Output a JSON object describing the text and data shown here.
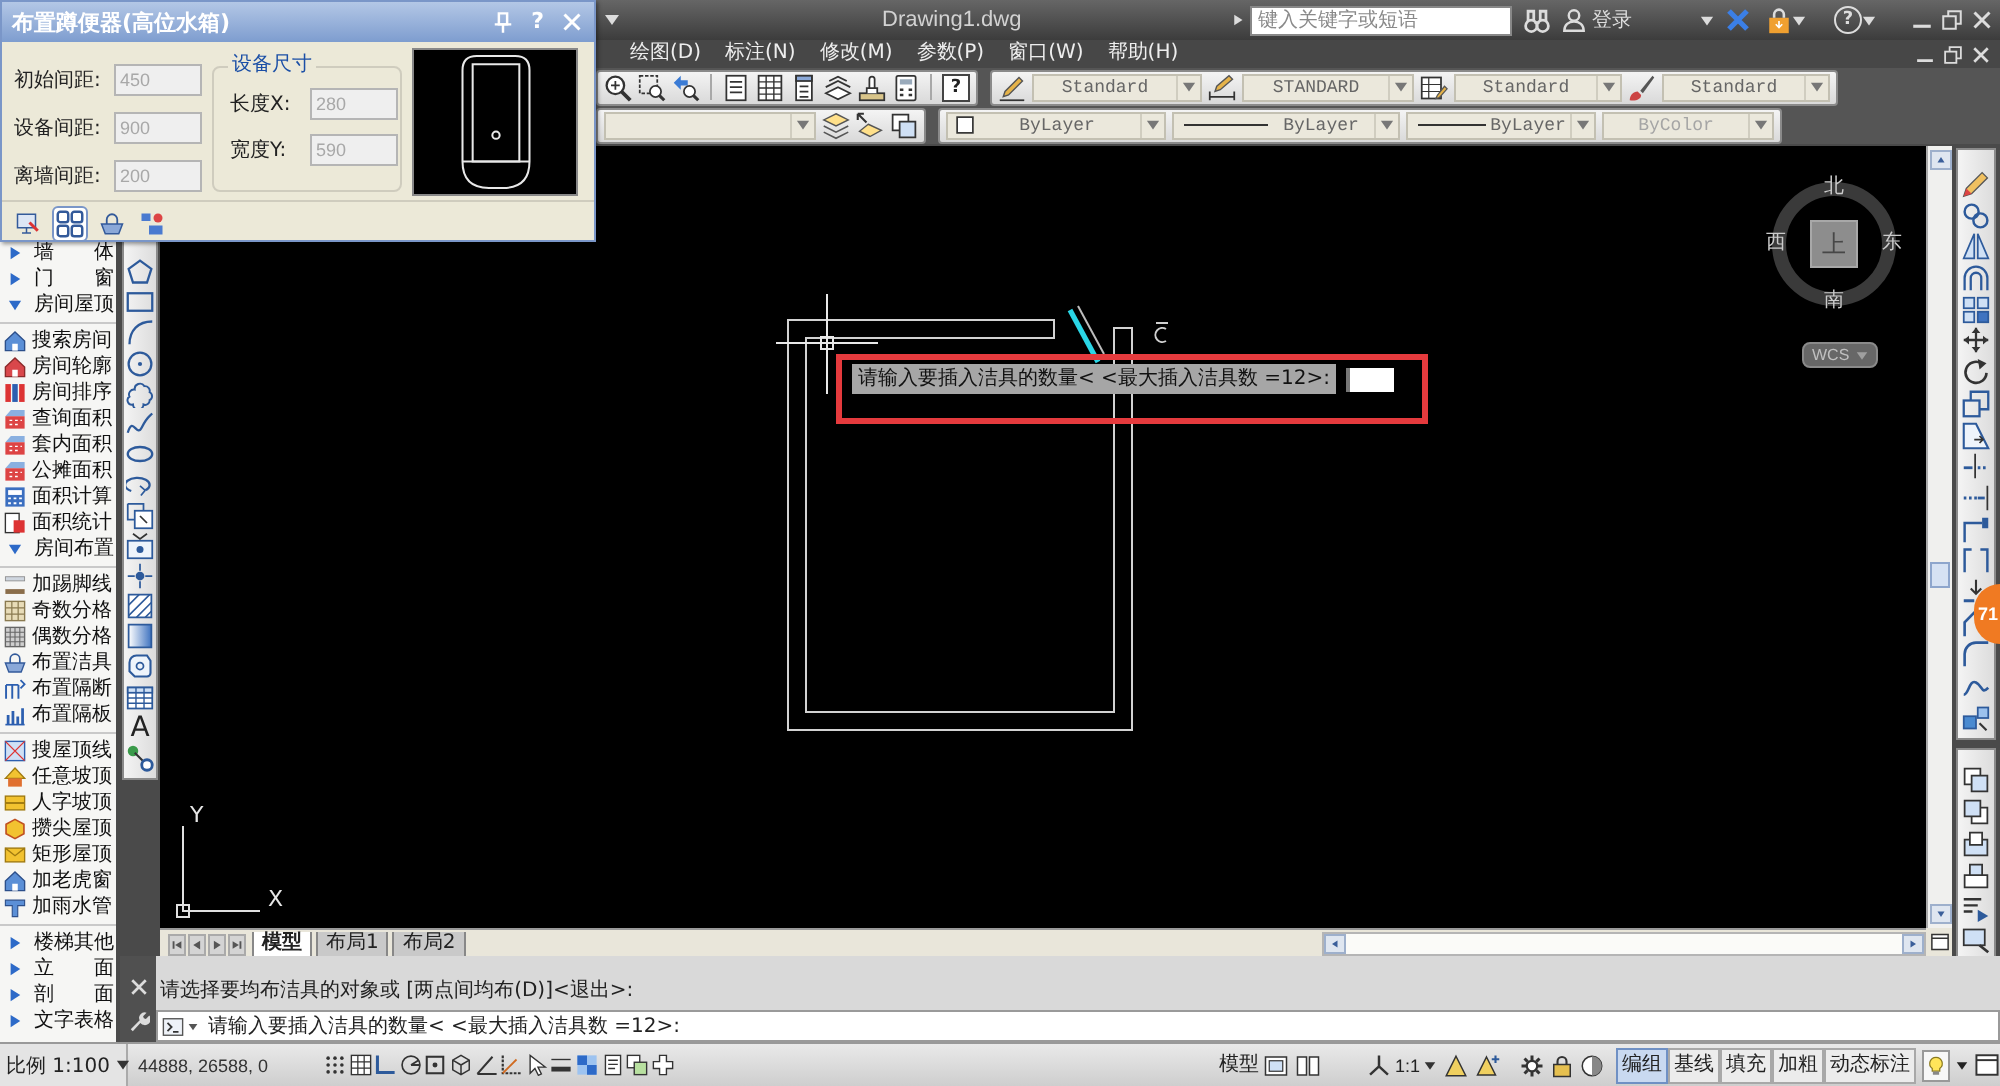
{
  "title_bar": {
    "title": "Drawing1.dwg",
    "search": {
      "placeholder": "键入关键字或短语"
    },
    "login": "登录",
    "help": "?"
  },
  "menu_bar": [
    "绘图(D)",
    "标注(N)",
    "修改(M)",
    "参数(P)",
    "窗口(W)",
    "帮助(H)"
  ],
  "standard_toolbar": {
    "help": "?"
  },
  "styles_toolbar": {
    "text_style": "Standard",
    "dimension_style": "STANDARD",
    "table_style": "Standard",
    "multileader_style": "Standard"
  },
  "properties_toolbar": {
    "color_property": "ByLayer",
    "linetype": "ByLayer",
    "lineweight": "ByLayer",
    "plot_style": {
      "value": "ByColor",
      "disabled": true
    }
  },
  "dialog": {
    "title": "布置蹲便器(高位水箱)",
    "help": "?",
    "fields": [
      {
        "label": "初始间距:",
        "value": "450",
        "disabled": true
      },
      {
        "label": "设备间距:",
        "value": "900",
        "disabled": true
      },
      {
        "label": "离墙间距:",
        "value": "200",
        "disabled": true
      }
    ],
    "size_group": {
      "title": "设备尺寸",
      "fields": [
        {
          "label": "长度X:",
          "value": "280",
          "disabled": true
        },
        {
          "label": "宽度Y:",
          "value": "590",
          "disabled": true
        }
      ]
    },
    "tools": [
      {
        "selected": false
      },
      {
        "selected": true
      },
      {
        "selected": false
      },
      {
        "selected": false
      }
    ]
  },
  "palette": [
    {
      "kind": "category",
      "label": "墙　　体",
      "expanded": false
    },
    {
      "kind": "category",
      "label": "门　　窗",
      "expanded": false
    },
    {
      "kind": "category",
      "label": "房间屋顶",
      "expanded": true,
      "children": [
        {
          "kind": "command",
          "label": "搜索房间"
        },
        {
          "kind": "command",
          "label": "房间轮廓"
        },
        {
          "kind": "command",
          "label": "房间排序"
        },
        {
          "kind": "command",
          "label": "查询面积"
        },
        {
          "kind": "command",
          "label": "套内面积"
        },
        {
          "kind": "command",
          "label": "公摊面积"
        },
        {
          "kind": "command",
          "label": "面积计算"
        },
        {
          "kind": "command",
          "label": "面积统计"
        },
        {
          "kind": "category",
          "label": "房间布置",
          "expanded": true,
          "children": [
            {
              "kind": "command",
              "label": "加踢脚线"
            },
            {
              "kind": "command",
              "label": "奇数分格"
            },
            {
              "kind": "command",
              "label": "偶数分格"
            },
            {
              "kind": "command",
              "label": "布置洁具"
            },
            {
              "kind": "command",
              "label": "布置隔断"
            },
            {
              "kind": "command",
              "label": "布置隔板"
            }
          ]
        },
        {
          "kind": "command",
          "label": "搜屋顶线"
        },
        {
          "kind": "command",
          "label": "任意坡顶"
        },
        {
          "kind": "command",
          "label": "人字坡顶"
        },
        {
          "kind": "command",
          "label": "攒尖屋顶"
        },
        {
          "kind": "command",
          "label": "矩形屋顶"
        },
        {
          "kind": "command",
          "label": "加老虎窗"
        },
        {
          "kind": "command",
          "label": "加雨水管"
        }
      ]
    },
    {
      "kind": "category",
      "label": "楼梯其他",
      "expanded": false
    },
    {
      "kind": "category",
      "label": "立　　面",
      "expanded": false
    },
    {
      "kind": "category",
      "label": "剖　　面",
      "expanded": false
    },
    {
      "kind": "category",
      "label": "文字表格",
      "expanded": false
    }
  ],
  "draw_toolbar": {
    "text_tool": "A"
  },
  "canvas": {
    "viewcube": {
      "north": "北",
      "west": "西",
      "face": "上",
      "east": "东",
      "south": "南",
      "coordinate_system": "WCS"
    },
    "dynamic_input": {
      "prompt": "请输入要插入洁具的数量< <最大插入洁具数 =12>:"
    },
    "ucs": {
      "y_label": "Y",
      "x_label": "X"
    }
  },
  "layout_tabs": [
    {
      "label": "模型",
      "selected": true
    },
    {
      "label": "布局1",
      "selected": false
    },
    {
      "label": "布局2",
      "selected": false
    }
  ],
  "command_line": {
    "history": "请选择要均布洁具的对象或 [两点间均布(D)]<退出>:",
    "prompt": "请输入要插入洁具的数量< <最大插入洁具数 =12>:"
  },
  "status_bar": {
    "scale": "比例 1:100",
    "coordinates": "44888, 26588, 0",
    "space": "模型",
    "annotation_scale": "1:1",
    "toggles": [
      {
        "label": "编组",
        "on": true
      },
      {
        "label": "基线",
        "on": false
      },
      {
        "label": "填充",
        "on": false
      },
      {
        "label": "加粗",
        "on": false
      },
      {
        "label": "动态标注",
        "on": false
      }
    ]
  },
  "notification_badge": "71"
}
